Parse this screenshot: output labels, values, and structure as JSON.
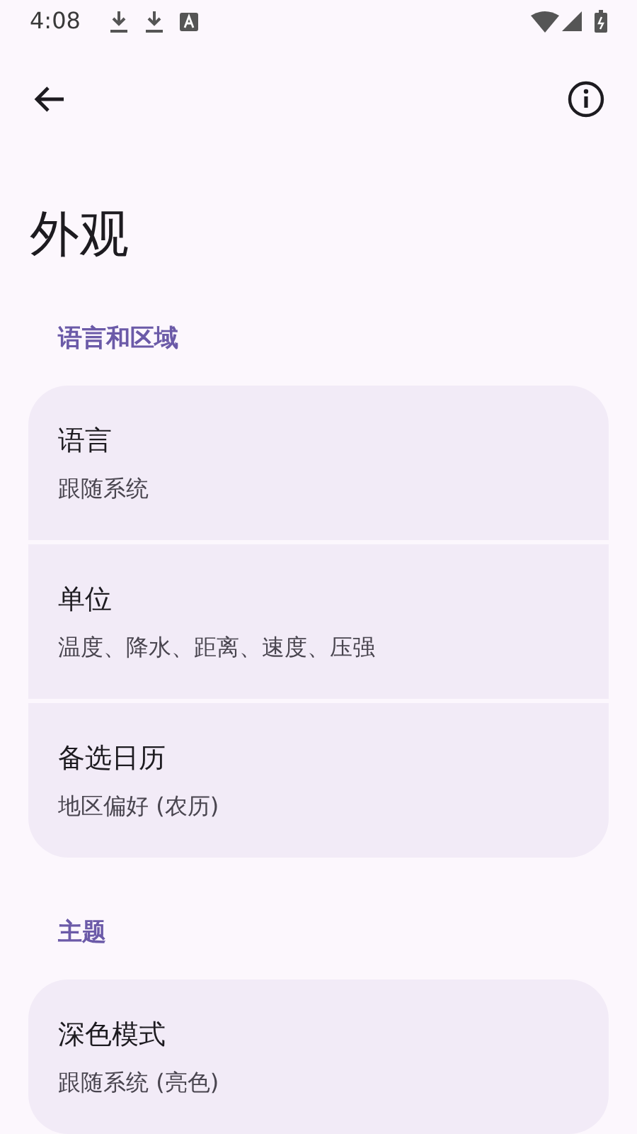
{
  "status_bar": {
    "time": "4:08"
  },
  "title": "外观",
  "sections": [
    {
      "header": "语言和区域",
      "items": [
        {
          "title": "语言",
          "subtitle": "跟随系统"
        },
        {
          "title": "单位",
          "subtitle": "温度、降水、距离、速度、压强"
        },
        {
          "title": "备选日历",
          "subtitle": "地区偏好 (农历)"
        }
      ]
    },
    {
      "header": "主题",
      "items": [
        {
          "title": "深色模式",
          "subtitle": "跟随系统 (亮色)"
        }
      ]
    }
  ]
}
